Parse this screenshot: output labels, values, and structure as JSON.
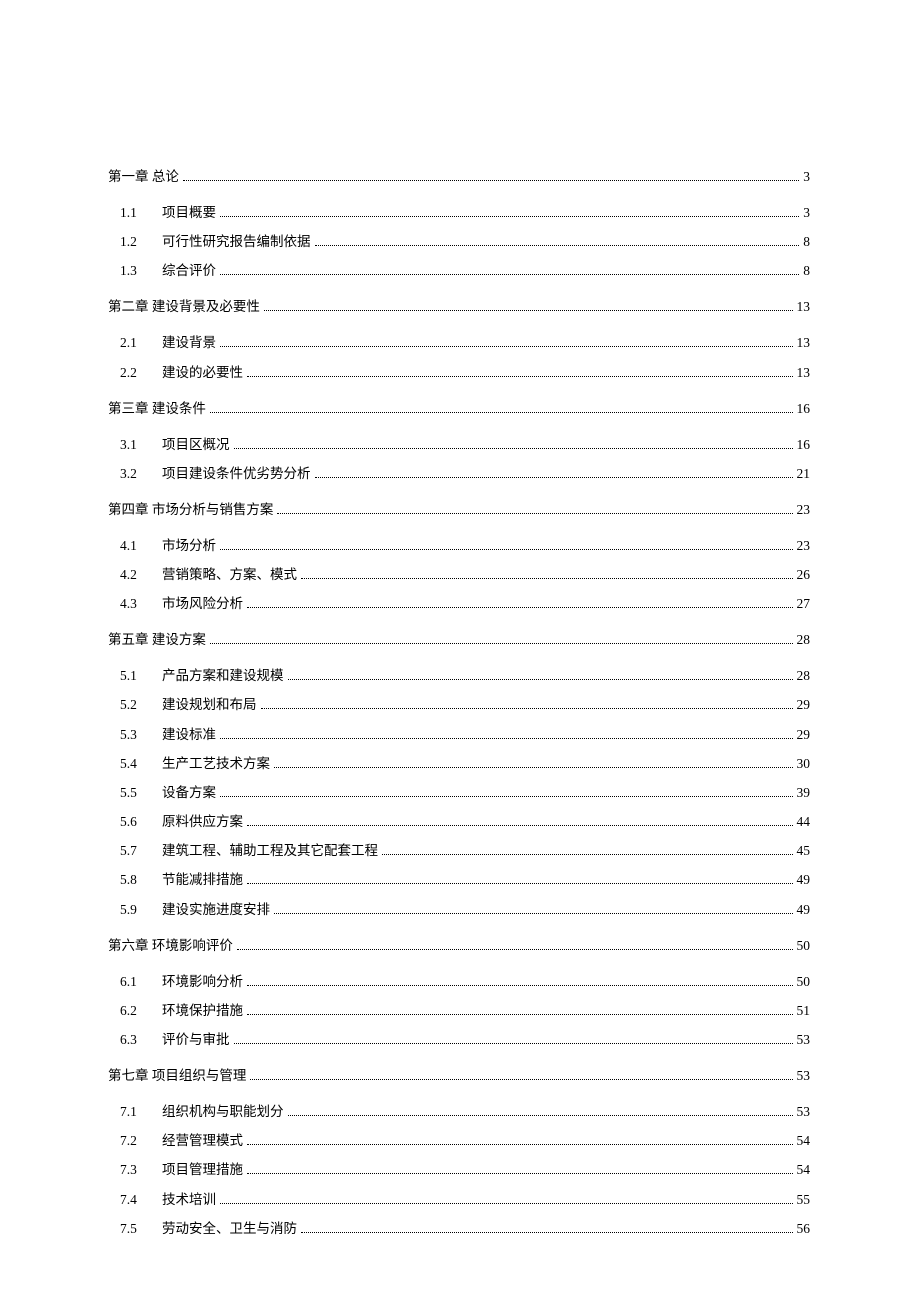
{
  "toc": [
    {
      "level": 1,
      "num": "",
      "title": "第一章 总论",
      "page": "3"
    },
    {
      "level": 2,
      "num": "1.1",
      "title": "项目概要",
      "page": "3"
    },
    {
      "level": 2,
      "num": "1.2",
      "title": "可行性研究报告编制依据",
      "page": "8"
    },
    {
      "level": 2,
      "num": "1.3",
      "title": "综合评价",
      "page": "8"
    },
    {
      "level": 1,
      "num": "",
      "title": "第二章 建设背景及必要性",
      "page": "13"
    },
    {
      "level": 2,
      "num": "2.1",
      "title": "建设背景",
      "page": "13"
    },
    {
      "level": 2,
      "num": "2.2",
      "title": "建设的必要性",
      "page": "13"
    },
    {
      "level": 1,
      "num": "",
      "title": "第三章 建设条件",
      "page": "16"
    },
    {
      "level": 2,
      "num": "3.1",
      "title": "项目区概况",
      "page": "16"
    },
    {
      "level": 2,
      "num": "3.2",
      "title": "项目建设条件优劣势分析",
      "page": "21"
    },
    {
      "level": 1,
      "num": "",
      "title": "第四章 市场分析与销售方案",
      "page": "23"
    },
    {
      "level": 2,
      "num": "4.1",
      "title": "市场分析",
      "page": "23"
    },
    {
      "level": 2,
      "num": "4.2",
      "title": "营销策略、方案、模式",
      "page": "26"
    },
    {
      "level": 2,
      "num": "4.3",
      "title": "市场风险分析",
      "page": "27"
    },
    {
      "level": 1,
      "num": "",
      "title": "第五章 建设方案",
      "page": "28"
    },
    {
      "level": 2,
      "num": "5.1",
      "title": "产品方案和建设规模",
      "page": "28"
    },
    {
      "level": 2,
      "num": "5.2",
      "title": "建设规划和布局",
      "page": "29"
    },
    {
      "level": 2,
      "num": "5.3",
      "title": "建设标准",
      "page": "29"
    },
    {
      "level": 2,
      "num": "5.4",
      "title": "生产工艺技术方案",
      "page": "30"
    },
    {
      "level": 2,
      "num": "5.5",
      "title": "设备方案",
      "page": "39"
    },
    {
      "level": 2,
      "num": "5.6",
      "title": "原料供应方案",
      "page": "44"
    },
    {
      "level": 2,
      "num": "5.7",
      "title": "建筑工程、辅助工程及其它配套工程",
      "page": "45"
    },
    {
      "level": 2,
      "num": "5.8",
      "title": "节能减排措施",
      "page": "49"
    },
    {
      "level": 2,
      "num": "5.9",
      "title": "建设实施进度安排",
      "page": "49"
    },
    {
      "level": 1,
      "num": "",
      "title": "第六章 环境影响评价",
      "page": "50"
    },
    {
      "level": 2,
      "num": "6.1",
      "title": "环境影响分析",
      "page": "50"
    },
    {
      "level": 2,
      "num": "6.2",
      "title": "环境保护措施",
      "page": "51"
    },
    {
      "level": 2,
      "num": "6.3",
      "title": "评价与审批",
      "page": "53"
    },
    {
      "level": 1,
      "num": "",
      "title": "第七章 项目组织与管理",
      "page": "53"
    },
    {
      "level": 2,
      "num": "7.1",
      "title": "组织机构与职能划分",
      "page": "53"
    },
    {
      "level": 2,
      "num": "7.2",
      "title": "经营管理模式",
      "page": "54"
    },
    {
      "level": 2,
      "num": "7.3",
      "title": "项目管理措施",
      "page": "54"
    },
    {
      "level": 2,
      "num": "7.4",
      "title": "技术培训",
      "page": "55"
    },
    {
      "level": 2,
      "num": "7.5",
      "title": "劳动安全、卫生与消防",
      "page": "56"
    }
  ]
}
